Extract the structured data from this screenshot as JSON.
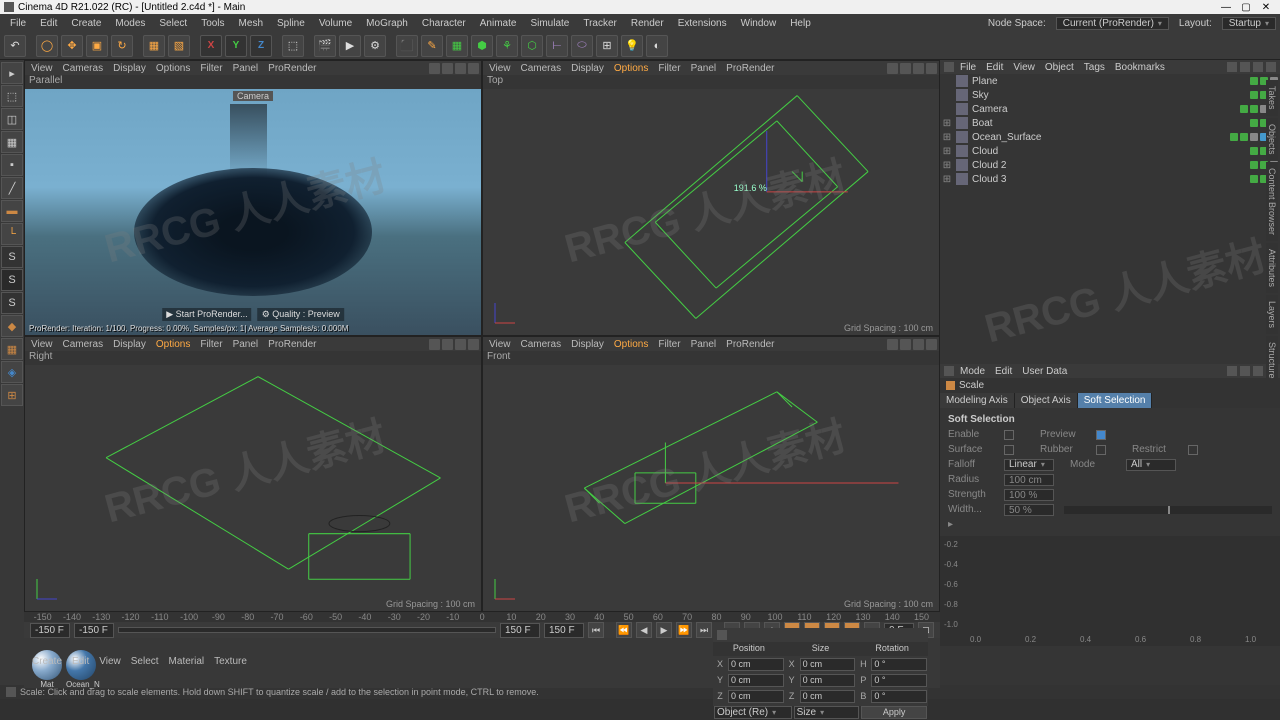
{
  "title": "Cinema 4D R21.022 (RC) - [Untitled 2.c4d *] - Main",
  "menubar": [
    "File",
    "Edit",
    "Create",
    "Modes",
    "Select",
    "Tools",
    "Mesh",
    "Spline",
    "Volume",
    "MoGraph",
    "Character",
    "Animate",
    "Simulate",
    "Tracker",
    "Render",
    "Extensions",
    "Window",
    "Help"
  ],
  "node_space_label": "Node Space:",
  "node_space_value": "Current (ProRender)",
  "layout_label": "Layout:",
  "layout_value": "Startup",
  "axes": [
    "X",
    "Y",
    "Z"
  ],
  "vp_menus": [
    "View",
    "Cameras",
    "Display",
    "Options",
    "Filter",
    "Panel",
    "ProRender"
  ],
  "vp": {
    "tl_title": "Parallel",
    "tl_cam": "Camera",
    "tl_btn1": "▶ Start ProRender...",
    "tl_btn2": "⚙ Quality : Preview",
    "tl_status": "ProRender: Iteration: 1/100, Progress: 0.00%, Samples/px: 1| Average Samples/s: 0.000M",
    "tr_title": "Top",
    "tr_label": "191.6 %",
    "bl_title": "Right",
    "br_title": "Front",
    "grid": "Grid Spacing : 100 cm"
  },
  "timeline": {
    "ticks": [
      -150,
      -140,
      -130,
      -120,
      -110,
      -100,
      -90,
      -80,
      -70,
      -60,
      -50,
      -40,
      -30,
      -20,
      -10,
      0,
      10,
      20,
      30,
      40,
      50,
      60,
      70,
      80,
      90,
      100,
      110,
      120,
      130,
      140,
      150
    ],
    "start": "-150 F",
    "start2": "-150 F",
    "end": "150 F",
    "end2": "150 F",
    "cur": "0 F"
  },
  "playback_icons": [
    "⏮",
    "⏪",
    "◀",
    "▶",
    "⏩",
    "⏭",
    "⏺"
  ],
  "mat_menu": [
    "Create",
    "Edit",
    "View",
    "Select",
    "Material",
    "Texture"
  ],
  "materials": [
    {
      "name": "Mat"
    },
    {
      "name": "Ocean_N"
    }
  ],
  "coord": {
    "headers": [
      "Position",
      "Size",
      "Rotation"
    ],
    "rows": [
      {
        "a": "X",
        "av": "0 cm",
        "b": "X",
        "bv": "0 cm",
        "c": "H",
        "cv": "0 °"
      },
      {
        "a": "Y",
        "av": "0 cm",
        "b": "Y",
        "bv": "0 cm",
        "c": "P",
        "cv": "0 °"
      },
      {
        "a": "Z",
        "av": "0 cm",
        "b": "Z",
        "bv": "0 cm",
        "c": "B",
        "cv": "0 °"
      }
    ],
    "obj_mode": "Object (Re)",
    "size_mode": "Size",
    "apply": "Apply"
  },
  "obj_menu": [
    "File",
    "Edit",
    "View",
    "Object",
    "Tags",
    "Bookmarks"
  ],
  "objects": [
    {
      "name": "Plane",
      "exp": "",
      "tags": [
        "g",
        "g",
        "w"
      ]
    },
    {
      "name": "Sky",
      "exp": "",
      "tags": [
        "g",
        "g",
        "c"
      ]
    },
    {
      "name": "Camera",
      "exp": "",
      "tags": [
        "g",
        "g",
        "w",
        "w"
      ]
    },
    {
      "name": "Boat",
      "exp": "⊞",
      "tags": [
        "g",
        "g",
        "c"
      ]
    },
    {
      "name": "Ocean_Surface",
      "exp": "⊞",
      "tags": [
        "g",
        "g",
        "w",
        "c",
        "o"
      ]
    },
    {
      "name": "Cloud",
      "exp": "⊞",
      "tags": [
        "g",
        "g",
        "w"
      ]
    },
    {
      "name": "Cloud 2",
      "exp": "⊞",
      "tags": [
        "g",
        "g",
        "w"
      ]
    },
    {
      "name": "Cloud 3",
      "exp": "⊞",
      "tags": [
        "g",
        "g",
        "w"
      ]
    }
  ],
  "attr_menu": [
    "Mode",
    "Edit",
    "User Data"
  ],
  "attr_title": "Scale",
  "attr_tabs": [
    "Modeling Axis",
    "Object Axis",
    "Soft Selection"
  ],
  "attr_section_title": "Soft Selection",
  "attr_fields": {
    "enable": "Enable",
    "preview": "Preview",
    "surface": "Surface",
    "rubber": "Rubber",
    "restrict": "Restrict",
    "falloff": "Falloff",
    "falloff_v": "Linear",
    "mode": "Mode",
    "mode_v": "All",
    "radius": "Radius",
    "radius_v": "100 cm",
    "strength": "Strength",
    "strength_v": "100 %",
    "width": "Width...",
    "width_v": "50 %"
  },
  "graph_y": [
    "-1.0",
    "-0.8",
    "-0.6",
    "-0.4",
    "-0.2"
  ],
  "graph_x": [
    "0.0",
    "0.2",
    "0.4",
    "0.6",
    "0.8",
    "1.0"
  ],
  "side_tabs": [
    "Takes",
    "Objects",
    "Content Browser",
    "Attributes",
    "Layers",
    "Structure"
  ],
  "status": "Scale: Click and drag to scale elements. Hold down SHIFT to quantize scale / add to the selection in point mode, CTRL to remove.",
  "watermark": "RRCG 人人素材"
}
